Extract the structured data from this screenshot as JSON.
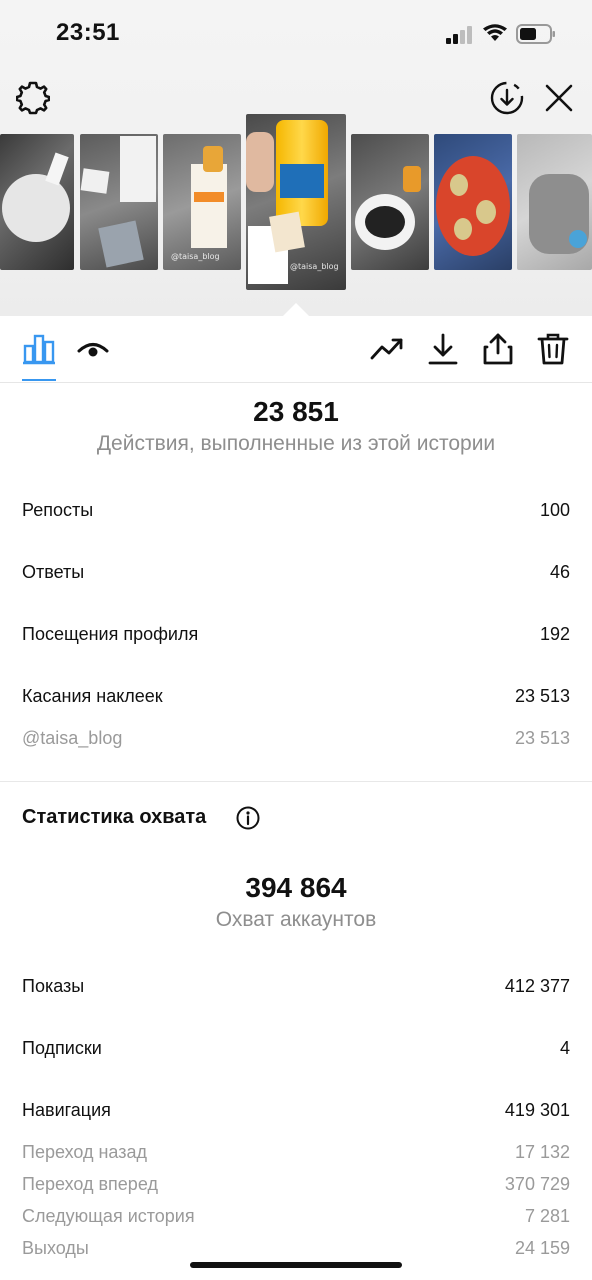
{
  "status_bar": {
    "time": "23:51"
  },
  "icons": {
    "settings": "gear-icon",
    "download_story": "download-circle-icon",
    "close": "close-icon",
    "insights_tab": "bar-chart-icon",
    "viewers_tab": "eye-icon",
    "promote": "trend-up-icon",
    "save": "download-icon",
    "share": "share-icon",
    "delete": "trash-icon",
    "info": "info-icon"
  },
  "story_strip": {
    "captions": [
      "@taisa_blog",
      "@taisa_blog"
    ],
    "selected_index": 3
  },
  "interactions": {
    "total": "23 851",
    "subtitle": "Действия, выполненные из этой истории",
    "rows": [
      {
        "label": "Репосты",
        "value": "100",
        "sub": false
      },
      {
        "label": "Ответы",
        "value": "46",
        "sub": false
      },
      {
        "label": "Посещения профиля",
        "value": "192",
        "sub": false
      },
      {
        "label": "Касания наклеек",
        "value": "23 513",
        "sub": false
      },
      {
        "label": "@taisa_blog",
        "value": "23 513",
        "sub": true
      }
    ]
  },
  "reach": {
    "section_title": "Статистика охвата",
    "total": "394 864",
    "subtitle": "Охват аккаунтов",
    "rows": [
      {
        "label": "Показы",
        "value": "412 377",
        "sub": false
      },
      {
        "label": "Подписки",
        "value": "4",
        "sub": false
      },
      {
        "label": "Навигация",
        "value": "419 301",
        "sub": false
      },
      {
        "label": "Переход назад",
        "value": "17 132",
        "sub": true
      },
      {
        "label": "Переход вперед",
        "value": "370 729",
        "sub": true
      },
      {
        "label": "Следующая история",
        "value": "7 281",
        "sub": true
      },
      {
        "label": "Выходы",
        "value": "24 159",
        "sub": true
      }
    ]
  },
  "colors": {
    "accent": "#3897f0",
    "muted": "#8e8e8e",
    "text": "#111111"
  }
}
